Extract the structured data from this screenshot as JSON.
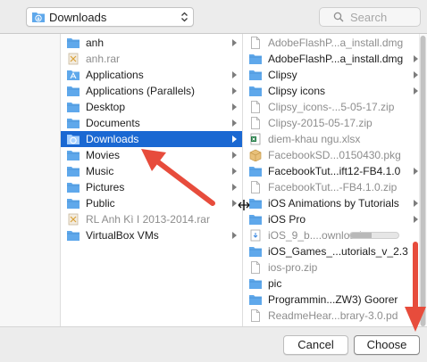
{
  "location": {
    "label": "Downloads",
    "icon": "downloads-folder-icon"
  },
  "search": {
    "placeholder": "Search"
  },
  "column1": [
    {
      "name": "anh",
      "kind": "folder",
      "arrow": true
    },
    {
      "name": "anh.rar",
      "kind": "archive",
      "arrow": false,
      "dim": true
    },
    {
      "name": "Applications",
      "kind": "app-folder",
      "arrow": true
    },
    {
      "name": "Applications (Parallels)",
      "kind": "folder",
      "arrow": true
    },
    {
      "name": "Desktop",
      "kind": "folder",
      "arrow": true
    },
    {
      "name": "Documents",
      "kind": "folder",
      "arrow": true
    },
    {
      "name": "Downloads",
      "kind": "downloads-folder",
      "arrow": true,
      "selected": true
    },
    {
      "name": "Movies",
      "kind": "folder",
      "arrow": true
    },
    {
      "name": "Music",
      "kind": "folder",
      "arrow": true
    },
    {
      "name": "Pictures",
      "kind": "folder",
      "arrow": true
    },
    {
      "name": "Public",
      "kind": "folder",
      "arrow": true
    },
    {
      "name": "RL Anh Kì I 2013-2014.rar",
      "kind": "archive",
      "arrow": false,
      "dim": true
    },
    {
      "name": "VirtualBox VMs",
      "kind": "folder",
      "arrow": true
    }
  ],
  "column2": [
    {
      "name": "AdobeFlashP...a_install.dmg",
      "kind": "file",
      "arrow": false,
      "dim": true
    },
    {
      "name": "AdobeFlashP...a_install.dmg",
      "kind": "folder",
      "arrow": true
    },
    {
      "name": "Clipsy",
      "kind": "folder",
      "arrow": true
    },
    {
      "name": "Clipsy icons",
      "kind": "folder",
      "arrow": true
    },
    {
      "name": "Clipsy_icons-...5-05-17.zip",
      "kind": "file",
      "arrow": false,
      "dim": true
    },
    {
      "name": "Clipsy-2015-05-17.zip",
      "kind": "file",
      "arrow": false,
      "dim": true
    },
    {
      "name": "diem-khau ngu.xlsx",
      "kind": "excel",
      "arrow": false,
      "dim": true
    },
    {
      "name": "FacebookSD...0150430.pkg",
      "kind": "package",
      "arrow": false,
      "dim": true
    },
    {
      "name": "FacebookTut...ift12-FB4.1.0",
      "kind": "folder",
      "arrow": true
    },
    {
      "name": "FacebookTut...-FB4.1.0.zip",
      "kind": "file",
      "arrow": false,
      "dim": true
    },
    {
      "name": "iOS Animations by Tutorials",
      "kind": "folder",
      "arrow": true
    },
    {
      "name": "iOS Pro",
      "kind": "folder",
      "arrow": true
    },
    {
      "name": "iOS_9_b....ownload",
      "kind": "download",
      "arrow": false,
      "dim": true,
      "progress": 0.45
    },
    {
      "name": "iOS_Games_...utorials_v_2.3",
      "kind": "folder",
      "arrow": true
    },
    {
      "name": "ios-pro.zip",
      "kind": "file",
      "arrow": false,
      "dim": true
    },
    {
      "name": "pic",
      "kind": "folder",
      "arrow": true
    },
    {
      "name": "Programmin...ZW3) Goorer",
      "kind": "folder",
      "arrow": true
    },
    {
      "name": "ReadmeHear...brary-3.0.pd",
      "kind": "file",
      "arrow": false,
      "dim": true
    }
  ],
  "buttons": {
    "cancel": "Cancel",
    "choose": "Choose"
  },
  "colors": {
    "selection": "#1a68d2",
    "folder": "#5fa8eb",
    "arrow": "#e74c3c"
  }
}
